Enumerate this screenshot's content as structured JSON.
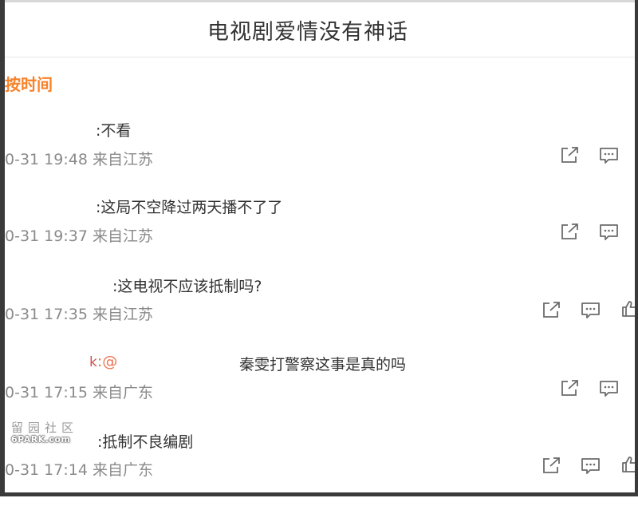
{
  "header": {
    "title": "电视剧爱情没有神话"
  },
  "sort": {
    "label": "按时间"
  },
  "comments": [
    {
      "text": ":不看",
      "time": "0-31 19:48",
      "source": "来自江苏"
    },
    {
      "text": ":这局不空降过两天播不了了",
      "time": "0-31 19:37",
      "source": "来自江苏"
    },
    {
      "text": ":这电视不应该抵制吗?",
      "time": "0-31 17:35",
      "source": "来自江苏"
    },
    {
      "prefix": "k",
      "mention": ":@",
      "text": "秦雯打警察这事是真的吗",
      "time": "0-31 17:15",
      "source": "来自广东"
    },
    {
      "text": ":抵制不良编剧",
      "time": "0-31 17:14",
      "source": "来自广东"
    }
  ],
  "watermark": {
    "chars": "留园社区",
    "site": "6PARK.com"
  },
  "icons": [
    "share-icon",
    "comment-icon",
    "like-icon"
  ],
  "colors": {
    "accent": "#f78128",
    "text": "#333333",
    "meta": "#8a8a8a",
    "icon": "#6b6b6b"
  }
}
